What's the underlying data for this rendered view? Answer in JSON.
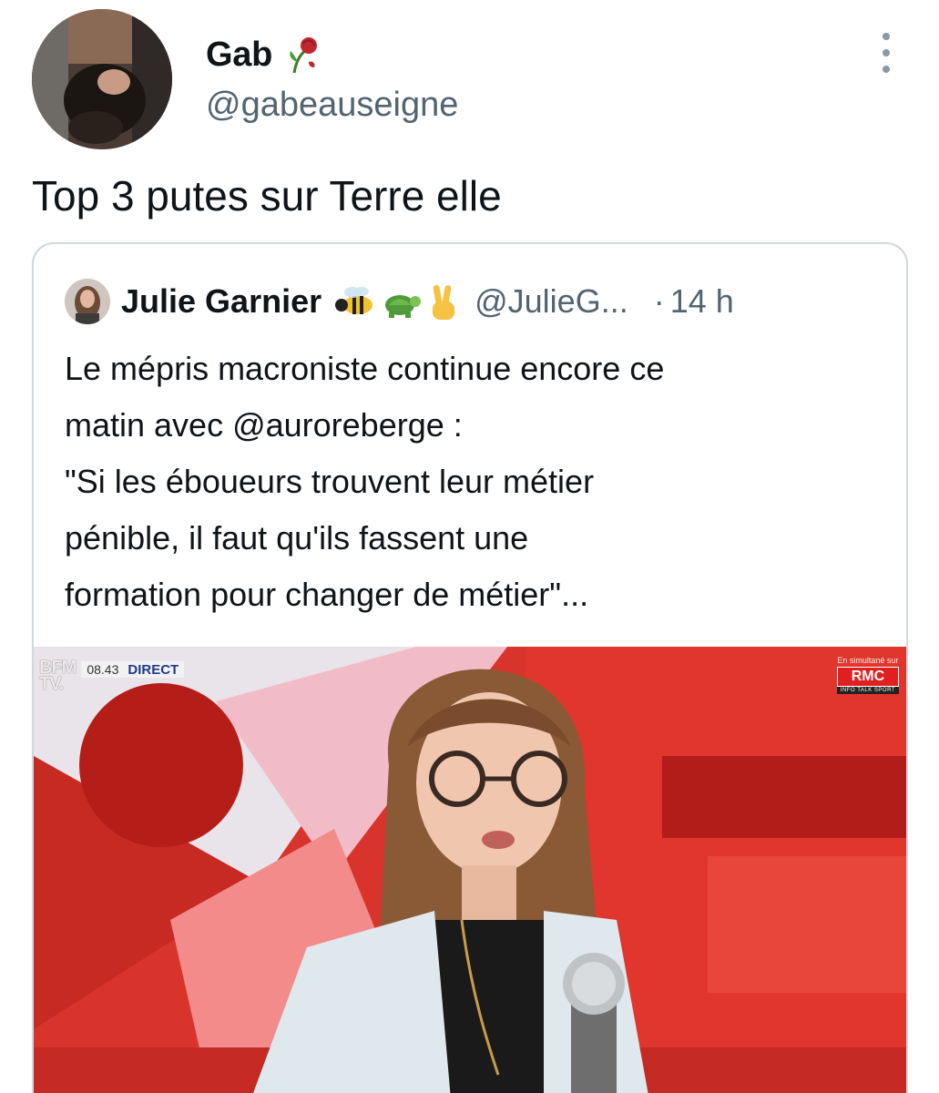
{
  "author": {
    "name": "Gab",
    "name_emoji": "wilted-rose",
    "handle": "@gabeauseigne",
    "avatar": "profile-photo"
  },
  "more_menu": {
    "icon": "more-vertical-icon"
  },
  "tweet": {
    "text": "Top 3 putes sur Terre elle"
  },
  "quote": {
    "author": {
      "name": "Julie Garnier",
      "emojis": [
        "bee",
        "turtle",
        "victory-hand"
      ],
      "handle": "@JulieG...",
      "separator": "·",
      "time": "14 h"
    },
    "lines": [
      "Le mépris macroniste continue encore ce",
      "matin avec @auroreberge :",
      "\"Si les éboueurs trouvent leur métier",
      "pénible, il faut qu'ils fassent une",
      "formation pour changer de métier\"..."
    ],
    "media": {
      "channel": "BFM\nTV.",
      "clock": "08.43",
      "live": "DIRECT",
      "simulcast_label": "En simultané sur",
      "simulcast_logo": "RMC",
      "simulcast_tag": "INFO TALK SPORT",
      "colors": {
        "background": "#d8342c",
        "accent": "#f28b8a"
      }
    }
  },
  "colors": {
    "text": "#0f1419",
    "secondary": "#536471",
    "border": "#cfd9de"
  }
}
